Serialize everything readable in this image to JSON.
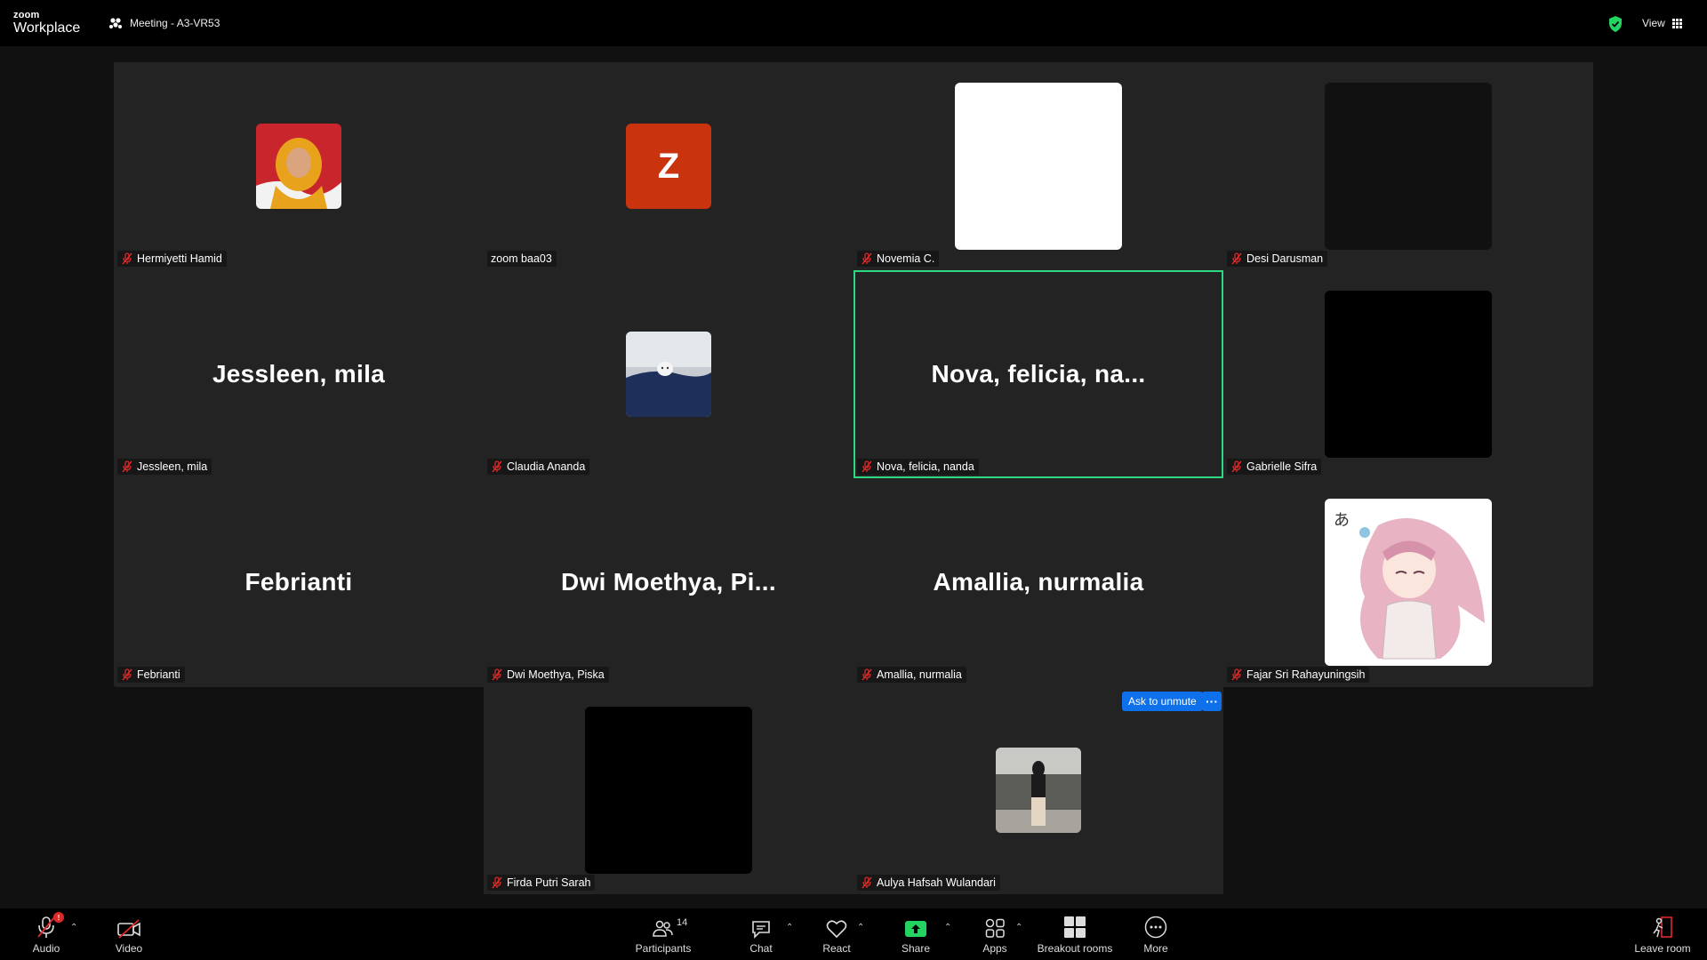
{
  "app": {
    "logo_small": "zoom",
    "logo_big": "Workplace"
  },
  "meeting": {
    "title": "Meeting - A3-VR53"
  },
  "header": {
    "view_label": "View"
  },
  "colors": {
    "active_speaker": "#2dd882",
    "accent": "#0e71eb",
    "share": "#23d560",
    "muted": "#e02828"
  },
  "tiles": [
    {
      "name": "Hermiyetti Hamid",
      "muted": true
    },
    {
      "name": "zoom baa03",
      "muted": false,
      "avatar_letter": "Z"
    },
    {
      "name": "Novemia C.",
      "muted": true
    },
    {
      "name": "Desi Darusman",
      "muted": true
    },
    {
      "name": "Jessleen, mila",
      "muted": true,
      "display_name": "Jessleen, mila"
    },
    {
      "name": "Claudia Ananda",
      "muted": true
    },
    {
      "name": "Nova, felicia, nanda",
      "muted": true,
      "display_name": "Nova, felicia, na..."
    },
    {
      "name": "Gabrielle Sifra",
      "muted": true
    },
    {
      "name": "Febrianti",
      "muted": true,
      "display_name": "Febrianti"
    },
    {
      "name": "Dwi Moethya, Piska",
      "muted": true,
      "display_name": "Dwi Moethya, Pi..."
    },
    {
      "name": "Amallia, nurmalia",
      "muted": true,
      "display_name": "Amallia, nurmalia"
    },
    {
      "name": "Fajar Sri Rahayuningsih",
      "muted": true,
      "avatar_glyph": "あ"
    },
    {
      "name": "Firda Putri Sarah",
      "muted": true
    },
    {
      "name": "Aulya Hafsah Wulandari",
      "muted": true
    }
  ],
  "ask_unmute": {
    "label": "Ask to unmute",
    "more": "···"
  },
  "toolbar": {
    "audio": "Audio",
    "audio_badge": "!",
    "video": "Video",
    "participants": "Participants",
    "participants_count": "14",
    "chat": "Chat",
    "react": "React",
    "share": "Share",
    "apps": "Apps",
    "breakout": "Breakout rooms",
    "more": "More",
    "leave": "Leave room"
  }
}
